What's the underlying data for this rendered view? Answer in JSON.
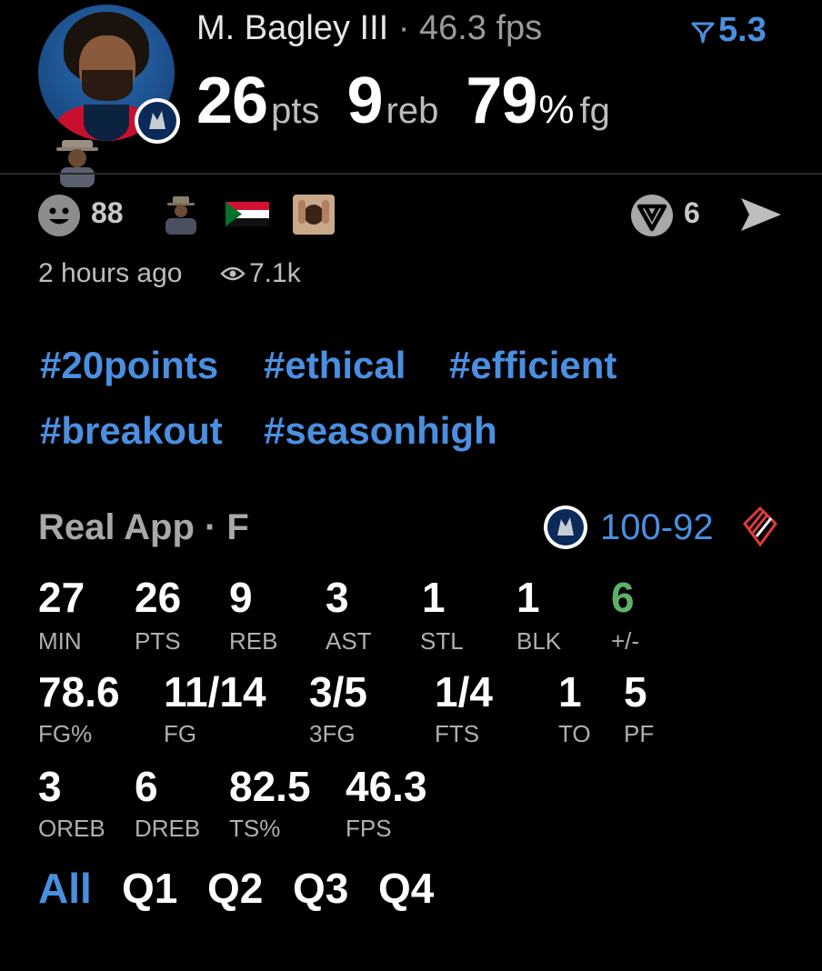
{
  "header": {
    "player_name": "M. Bagley III",
    "separator": " · ",
    "fps_text": "46.3 fps",
    "rating": "5.3",
    "points": "26",
    "points_unit": "pts",
    "rebounds": "9",
    "rebounds_unit": "reb",
    "fg_pct": "79",
    "fg_pct_unit": "%",
    "fg_label": "fg"
  },
  "reactions": {
    "count": "88",
    "verse_count": "6",
    "timestamp": "2 hours ago",
    "views": "7.1k"
  },
  "hashtags": [
    "#20points",
    "#ethical",
    "#efficient",
    "#breakout",
    "#seasonhigh"
  ],
  "game": {
    "source": "Real App · F",
    "score_home": "100",
    "score_sep": "-",
    "score_away": "92"
  },
  "stats": {
    "row1": [
      {
        "value": "27",
        "label": "MIN"
      },
      {
        "value": "26",
        "label": "PTS"
      },
      {
        "value": "9",
        "label": "REB"
      },
      {
        "value": "3",
        "label": "AST"
      },
      {
        "value": "1",
        "label": "STL"
      },
      {
        "value": "1",
        "label": "BLK"
      },
      {
        "value": "6",
        "label": "+/-"
      }
    ],
    "row2": [
      {
        "value": "78.6",
        "label": "FG%"
      },
      {
        "value": "11/14",
        "label": "FG"
      },
      {
        "value": "3/5",
        "label": "3FG"
      },
      {
        "value": "1/4",
        "label": "FTS"
      },
      {
        "value": "1",
        "label": "TO"
      },
      {
        "value": "5",
        "label": "PF"
      }
    ],
    "row3": [
      {
        "value": "3",
        "label": "OREB"
      },
      {
        "value": "6",
        "label": "DREB"
      },
      {
        "value": "82.5",
        "label": "TS%"
      },
      {
        "value": "46.3",
        "label": "FPS"
      }
    ]
  },
  "tabs": [
    "All",
    "Q1",
    "Q2",
    "Q3",
    "Q4"
  ],
  "colors": {
    "accent": "#4a8fe0",
    "positive": "#5bb36a",
    "background": "#000000"
  },
  "icons": [
    "player-avatar",
    "team-logo-icon",
    "filter-icon",
    "smiley-icon",
    "flag-icon",
    "verse-icon",
    "send-icon",
    "eye-icon",
    "opponent-logo-icon"
  ]
}
